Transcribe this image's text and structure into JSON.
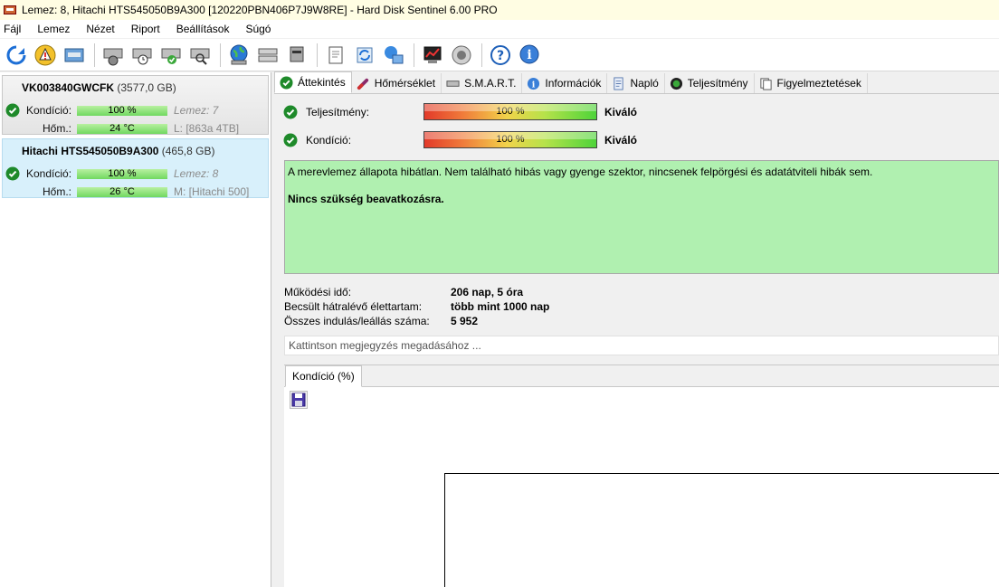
{
  "window": {
    "title": "Lemez: 8, Hitachi HTS545050B9A300 [120220PBN406P7J9W8RE]  -  Hard Disk Sentinel 6.00 PRO"
  },
  "menu": [
    "Fájl",
    "Lemez",
    "Nézet",
    "Riport",
    "Beállítások",
    "Súgó"
  ],
  "toolbar": {
    "icons": [
      "refresh-icon",
      "alert-icon",
      "disk-panel-icon",
      "disk-test-icon",
      "disk-clock-icon",
      "disk-ok-icon",
      "disk-search-icon",
      "globe-icon",
      "server-icon",
      "network-disk-icon",
      "report-icon",
      "sync-icon",
      "network-icon",
      "graph-icon",
      "speaker-icon",
      "help-icon",
      "info-icon"
    ]
  },
  "disks": [
    {
      "name": "VK003840GWCFK",
      "size": "(3577,0 GB)",
      "condition_label": "Kondíció:",
      "condition_value": "100 %",
      "condition_fraction": 1.0,
      "temp_label": "Hőm.:",
      "temp_value": "24 °C",
      "disk_index": "Lemez: 7",
      "partition": "L: [863a 4TB]"
    },
    {
      "name": "Hitachi HTS545050B9A300",
      "size": "(465,8 GB)",
      "condition_label": "Kondíció:",
      "condition_value": "100 %",
      "condition_fraction": 1.0,
      "temp_label": "Hőm.:",
      "temp_value": "26 °C",
      "disk_index": "Lemez: 8",
      "partition": "M: [Hitachi 500]"
    }
  ],
  "tabs": [
    "Áttekintés",
    "Hőmérséklet",
    "S.M.A.R.T.",
    "Információk",
    "Napló",
    "Teljesítmény",
    "Figyelmeztetések"
  ],
  "overview": {
    "performance_label": "Teljesítmény:",
    "performance_value": "100 %",
    "performance_fraction": 1.0,
    "performance_rating": "Kiváló",
    "condition_label": "Kondíció:",
    "condition_value": "100 %",
    "condition_fraction": 1.0,
    "condition_rating": "Kiváló",
    "status_text": "A merevlemez állapota hibátlan. Nem található hibás vagy gyenge szektor, nincsenek felpörgési és adatátviteli hibák sem.",
    "advice_text": "Nincs szükség beavatkozásra.",
    "stats": [
      {
        "label": "Működési idő:",
        "value": "206 nap, 5 óra"
      },
      {
        "label": "Becsült hátralévő élettartam:",
        "value": "több mint 1000 nap"
      },
      {
        "label": "Összes indulás/leállás száma:",
        "value": "5 952"
      }
    ],
    "note_placeholder": "Kattintson megjegyzés megadásához ...",
    "chart_tab": "Kondíció  (%)"
  },
  "colors": {
    "status_ok_bg": "#b0f0b0",
    "selected_disk_bg": "#d8f0fb",
    "title_bar_bg": "#fffde3",
    "check_green": "#1e8a2a"
  }
}
